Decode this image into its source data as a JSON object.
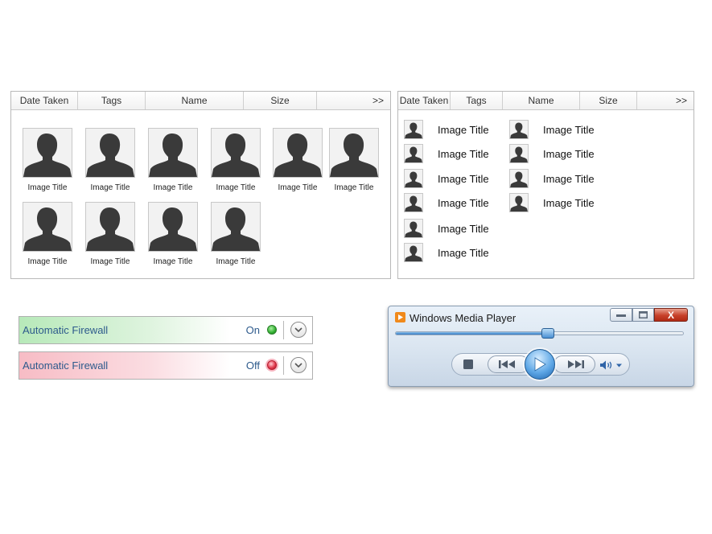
{
  "columns": {
    "date_taken": "Date Taken",
    "tags": "Tags",
    "name": "Name",
    "size": "Size",
    "more": ">>"
  },
  "thumbnail_panel": {
    "items": [
      {
        "title": "Image Title"
      },
      {
        "title": "Image Title"
      },
      {
        "title": "Image Title"
      },
      {
        "title": "Image Title"
      },
      {
        "title": "Image Title"
      },
      {
        "title": "Image Title"
      },
      {
        "title": "Image Title"
      },
      {
        "title": "Image Title"
      },
      {
        "title": "Image Title"
      },
      {
        "title": "Image Title"
      }
    ]
  },
  "list_panel": {
    "items": [
      {
        "title": "Image Title"
      },
      {
        "title": "Image Title"
      },
      {
        "title": "Image Title"
      },
      {
        "title": "Image Title"
      },
      {
        "title": "Image Title"
      },
      {
        "title": "Image Title"
      },
      {
        "title": "Image Title"
      },
      {
        "title": "Image Title"
      },
      {
        "title": "Image Title"
      },
      {
        "title": "Image Title"
      }
    ]
  },
  "firewall": [
    {
      "label": "Automatic Firewall",
      "state": "On",
      "status_color": "#2fae2f"
    },
    {
      "label": "Automatic Firewall",
      "state": "Off",
      "status_color": "#e23c50"
    }
  ],
  "media_player": {
    "title": "Windows Media Player",
    "close_label": "X",
    "seek_progress": 0.53,
    "icons": [
      "app-icon",
      "minimize-icon",
      "maximize-icon",
      "stop-icon",
      "previous-icon",
      "play-icon",
      "next-icon",
      "volume-icon"
    ]
  },
  "colors": {
    "label_blue": "#2d5a8c",
    "silhouette": "#3a3a3a",
    "close_red": "#c7402a",
    "accent_blue": "#2f78c2"
  }
}
